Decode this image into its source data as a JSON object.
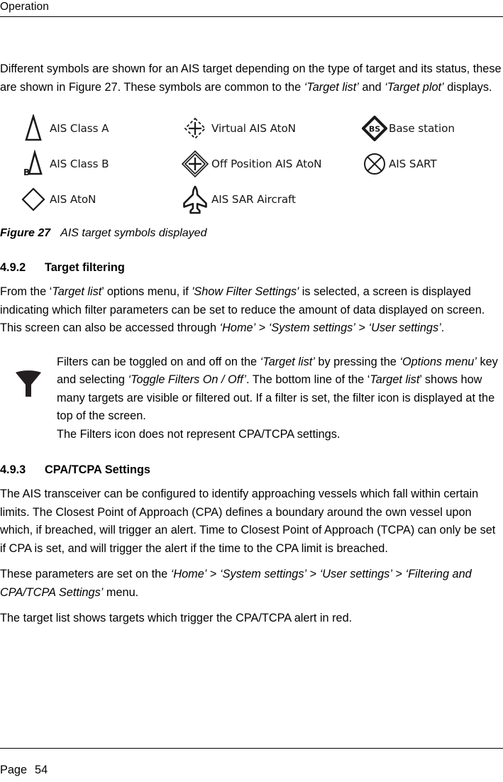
{
  "header": {
    "running_head": "Operation"
  },
  "intro": {
    "line_1_a": "Different symbols are shown for an AIS target depending on the type of target and its status, these are shown in Figure 27. These symbols are common to the ",
    "target_list": "‘Target list’",
    "and": " and ",
    "target_plot": "‘Target plot’",
    "line_1_b": " displays."
  },
  "figure": {
    "symbols": [
      {
        "icon": "ais-class-a-triangle-icon",
        "label": "AIS Class A",
        "column": 1,
        "row": 1
      },
      {
        "icon": "ais-class-b-triangle-b-icon",
        "label": "AIS Class B",
        "column": 1,
        "row": 2
      },
      {
        "icon": "ais-aton-diamond-icon",
        "label": "AIS AtoN",
        "column": 1,
        "row": 3
      },
      {
        "icon": "virtual-ais-aton-dashed-diamond-plus-icon",
        "label": "Virtual AIS AtoN",
        "column": 2,
        "row": 1
      },
      {
        "icon": "off-position-ais-aton-double-diamond-plus-icon",
        "label": "Off Position AIS AtoN",
        "column": 2,
        "row": 2
      },
      {
        "icon": "ais-sar-aircraft-icon",
        "label": "AIS SAR Aircraft",
        "column": 2,
        "row": 3
      },
      {
        "icon": "base-station-bs-diamond-icon",
        "label": "Base station",
        "column": 3,
        "row": 1
      },
      {
        "icon": "ais-sart-circle-cross-icon",
        "label": "AIS SART",
        "column": 3,
        "row": 2
      }
    ],
    "base_station_glyph_text": "BS",
    "class_b_glyph_text": "B",
    "caption_number": "Figure 27",
    "caption_text": "AIS target symbols displayed"
  },
  "sections": {
    "target_filtering": {
      "number": "4.9.2",
      "title": "Target filtering",
      "paragraph": {
        "p1": "From the ‘",
        "target_list": "Target list",
        "p2": "’ options menu, if ",
        "show_filter_settings": "'Show Filter Settings'",
        "p3": " is selected, a screen is displayed indicating which filter parameters can be set to reduce the amount of data displayed on screen. This screen can also be accessed through ",
        "home": "‘Home’",
        "gt1": " > ",
        "system_settings": "‘System settings’",
        "gt2": " > ",
        "user_settings": "‘User settings’",
        "p4": "."
      }
    },
    "cpa_tcpa": {
      "number": "4.9.3",
      "title": "CPA/TCPA Settings",
      "paragraph_1": "The AIS transceiver can be configured to identify approaching vessels which fall within certain limits. The Closest Point of Approach (CPA) defines a boundary around the own vessel upon which, if breached, will trigger an alert. Time to Closest Point of Approach (TCPA) can only be set if CPA is set, and will trigger the alert if the time to the CPA limit is breached.",
      "paragraph_2": {
        "p1": "These parameters are set on the ",
        "home": "‘Home’",
        "gt1": " > ",
        "system_settings": "‘System settings’",
        "gt2": " > ",
        "user_settings": "‘User settings’",
        "gt3": " > ",
        "filtering_cpa_tcpa": "‘Filtering and CPA/TCPA Settings’",
        "p2": " menu."
      },
      "paragraph_3": "The target list shows targets which trigger the CPA/TCPA alert in red."
    }
  },
  "note": {
    "icon": "filter-funnel-icon",
    "line1_a": "Filters can be toggled on and off on the ",
    "target_list": "‘Target list’",
    "line1_b": " by pressing the ",
    "options_menu": "‘Options menu’",
    "line1_c": " key and selecting ",
    "toggle_filters": "‘Toggle Filters On / Off’",
    "line1_d": ". The bottom line of the ‘",
    "target_list_2": "Target list",
    "line1_e": "’ shows how many targets are visible or filtered out. If a filter is set, the filter icon is displayed at the top of the screen.",
    "line2": "The Filters icon does not represent CPA/TCPA settings."
  },
  "footer": {
    "page_label": "Page",
    "page_number": "54"
  },
  "colors": {
    "text": "#000000",
    "symbol_stroke": "#1a1a1a",
    "rule": "#000000",
    "background": "#ffffff"
  }
}
